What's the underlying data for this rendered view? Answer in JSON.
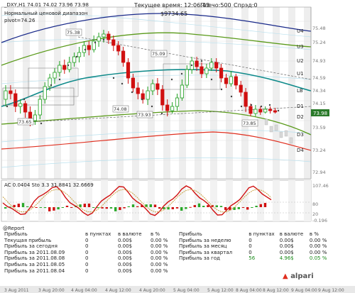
{
  "header": {
    "symbol_line": "_DXY,H1  74.01 74.02 73.96 73.98",
    "server_time": "Текущее время: 12:06:43",
    "leverage": "Плечо:500",
    "spread": "Спрэд:0",
    "balance": "$9734.65",
    "range_label": "Нормальный ценовой диапазон",
    "pivot": "pivot=74.26"
  },
  "level_labels": [
    "U4",
    "U3",
    "U2",
    "U1",
    "LB",
    "D1",
    "D2",
    "D3",
    "D4"
  ],
  "price_axis": [
    "75.48",
    "75.24",
    "74.93",
    "74.59",
    "74.34",
    "74.15",
    "73.98",
    "73.59",
    "73.24",
    "72.94"
  ],
  "current_price": "73.98",
  "price_marks": [
    "75.38",
    "75.09",
    "74.08",
    "73.93",
    "73.85",
    "73.65"
  ],
  "oscillator": {
    "header": "AC 0.0404   Sto 3.3 31.8841 32.6669",
    "axis": [
      "107.46",
      "80",
      "20",
      "-0.196"
    ]
  },
  "report": {
    "title": "@Report",
    "col_headers": [
      "в пунктах",
      "в валюте",
      "в %"
    ],
    "left_rows": [
      {
        "label": "Прибыль",
        "pts": "",
        "cur": "",
        "pct": ""
      },
      {
        "label": "Текущая прибыль",
        "pts": "0",
        "cur": "0.00$",
        "pct": "0.00 %"
      },
      {
        "label": "Прибыль за сегодня",
        "pts": "0",
        "cur": "0.00$",
        "pct": "0.00 %"
      },
      {
        "label": "Прибыль за 2011.08.09",
        "pts": "0",
        "cur": "0.00$",
        "pct": "0.00 %"
      },
      {
        "label": "Прибыль за 2011.08.08",
        "pts": "0",
        "cur": "0.00$",
        "pct": "0.00 %"
      },
      {
        "label": "Прибыль за 2011.08.05",
        "pts": "0",
        "cur": "0.00$",
        "pct": "0.00 %"
      },
      {
        "label": "Прибыль за 2011.08.04",
        "pts": "0",
        "cur": "0.00$",
        "pct": "0.00 %"
      }
    ],
    "right_rows": [
      {
        "label": "Прибыль",
        "pts": "",
        "cur": "",
        "pct": ""
      },
      {
        "label": "Прибыль за неделю",
        "pts": "0",
        "cur": "0.00$",
        "pct": "0.00 %"
      },
      {
        "label": "Прибыль за месяц",
        "pts": "0",
        "cur": "0.00$",
        "pct": "0.00 %"
      },
      {
        "label": "Прибыль за квартал",
        "pts": "0",
        "cur": "0.00$",
        "pct": "0.00 %"
      },
      {
        "label": "Прибыль за год",
        "pts": "56",
        "cur": "4.96$",
        "pct": "0.05 %"
      }
    ],
    "logo": "alpari"
  },
  "time_axis": [
    "3 Aug 2011",
    "3 Aug 20:00",
    "4 Aug 04:00",
    "4 Aug 12:00",
    "4 Aug 20:00",
    "5 Aug 04:00",
    "5 Aug 12:00",
    "8 Aug 04:00",
    "8 Aug 12:00",
    "9 Aug 04:00",
    "9 Aug 12:00"
  ],
  "colors": {
    "up_candle": "#1fa01f",
    "down_candle": "#d01010",
    "ma_teal": "#0e8a8a",
    "band_olive": "#5a9a1a",
    "band_navy": "#1a2a8a",
    "band_red": "#e03020",
    "ac_green": "#2aa82a",
    "ac_red": "#d01010"
  }
}
